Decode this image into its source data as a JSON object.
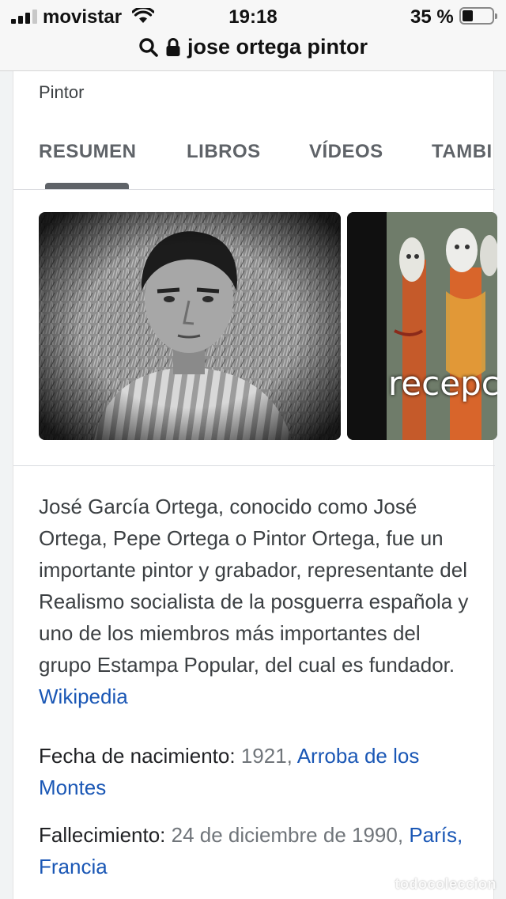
{
  "status_bar": {
    "carrier": "movistar",
    "time": "19:18",
    "battery": "35 %",
    "battery_level_percent": 35,
    "signal_bars_active": 3,
    "signal_bars_total": 4
  },
  "url_bar": {
    "query": "jose ortega pintor",
    "search_icon": "search-icon",
    "lock_icon": "lock-icon"
  },
  "knowledge_panel": {
    "subtitle": "Pintor",
    "tabs": [
      {
        "label": "RESUMEN",
        "active": true
      },
      {
        "label": "LIBROS",
        "active": false
      },
      {
        "label": "VÍDEOS",
        "active": false
      },
      {
        "label": "TAMBI",
        "active": false
      }
    ],
    "image_caption_overlay": "recepc",
    "description": "José García Ortega, conocido como José Ortega, Pepe Ortega o Pintor Ortega, fue un importante pintor y grabador, representante del Realismo socialista de la posguerra española y uno de los miembros más importantes del grupo Estampa Popular, del cual es fundador.",
    "source_link": "Wikipedia",
    "facts": [
      {
        "label": "Fecha de nacimiento:",
        "value": "1921,",
        "link": "Arroba de los Montes"
      },
      {
        "label": "Fallecimiento:",
        "value": "24 de diciembre de 1990,",
        "link": "París, Francia"
      }
    ]
  },
  "watermark": "todocoleccion",
  "colors": {
    "link": "#1a57b5",
    "tab_text": "#5f6368",
    "background": "#f1f3f4"
  }
}
